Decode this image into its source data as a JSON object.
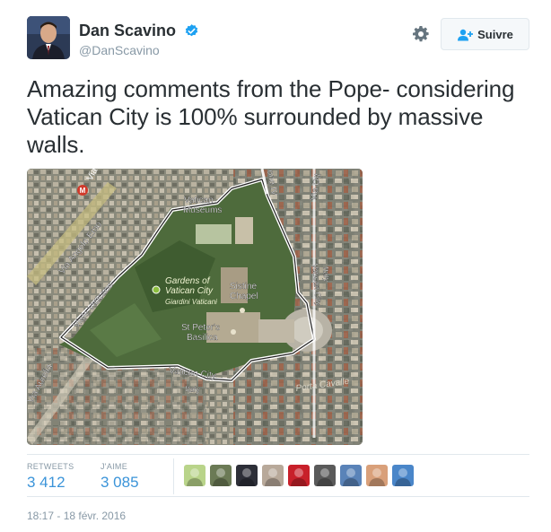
{
  "user": {
    "name": "Dan Scavino",
    "handle": "@DanScavino",
    "verified_icon": "verified-badge-icon"
  },
  "actions": {
    "settings_icon": "gear-icon",
    "follow_label": "Suivre",
    "follow_icon": "add-user-icon"
  },
  "tweet": {
    "text": "Amazing comments from the Pope- considering Vatican City is 100% surrounded by massive walls."
  },
  "map": {
    "labels": {
      "via_leone": "Via",
      "metro": "M",
      "via_angelo_emo": "Via Angelo Emo",
      "viale_vaticano_nw": "Viale Vaticano",
      "via_aurelia": "Via Aurelia",
      "vatican_museums": "Vatican\nMuseums",
      "gardens": "Gardens of\nVatican City",
      "giardini": "Giardini Vaticani",
      "sistine": "Sistine\nChapel",
      "st_peters": "St Peter's\nBasilica",
      "vatican_city": "Vatican City",
      "italy_bottom": "Italy",
      "italy_right": "Italy",
      "vatican_city_right": "Vatican City",
      "via_ottaviano": "Via Ott",
      "leone_iv": "one IV",
      "porta_cavalleggeri": "Porta Cavalle"
    }
  },
  "stats": {
    "retweets_label": "RETWEETS",
    "retweets_value": "3 412",
    "likes_label": "J'AIME",
    "likes_value": "3 085"
  },
  "likers": [
    {
      "name": "liker-avatar-1",
      "color": "#b9d48a"
    },
    {
      "name": "liker-avatar-2",
      "color": "#6b7a55"
    },
    {
      "name": "liker-avatar-3",
      "color": "#2d2f38"
    },
    {
      "name": "liker-avatar-4",
      "color": "#b8a99a"
    },
    {
      "name": "liker-avatar-5",
      "color": "#c8202a"
    },
    {
      "name": "liker-avatar-6",
      "color": "#5a5a5a"
    },
    {
      "name": "liker-avatar-7",
      "color": "#5a83b8"
    },
    {
      "name": "liker-avatar-8",
      "color": "#d9a07a"
    },
    {
      "name": "liker-avatar-9",
      "color": "#4a86c9"
    }
  ],
  "timestamp": "18:17 - 18 févr. 2016",
  "colors": {
    "link_blue": "#3b94d9",
    "verified_blue": "#1da1f2",
    "muted_gray": "#8899a6",
    "text_dark": "#292f33"
  }
}
